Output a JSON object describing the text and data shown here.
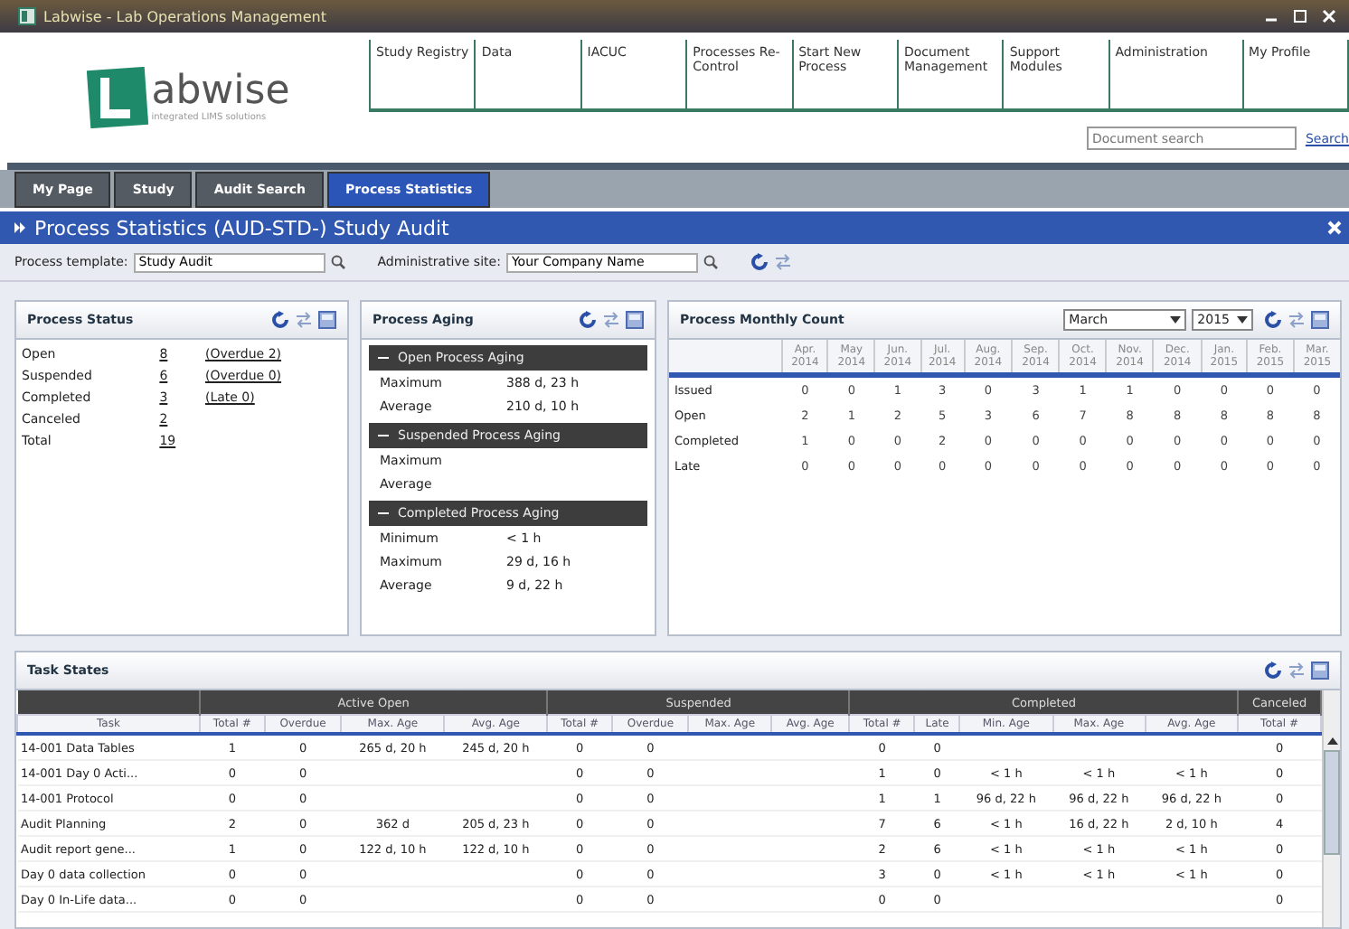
{
  "window": {
    "title": "Labwise - Lab Operations Management"
  },
  "logo": {
    "text": "abwise",
    "tagline": "integrated LIMS solutions"
  },
  "nav": [
    "Study Registry",
    "Data",
    "IACUC",
    "Processes Re-Control",
    "Start New Process",
    "Document Management",
    "Support Modules",
    "Administration",
    "My Profile"
  ],
  "search": {
    "placeholder": "Document search",
    "link": "Search"
  },
  "tabs": [
    {
      "label": "My Page",
      "selected": false
    },
    {
      "label": "Study",
      "selected": false
    },
    {
      "label": "Audit Search",
      "selected": false
    },
    {
      "label": "Process Statistics",
      "selected": true
    }
  ],
  "page_title": "Process Statistics (AUD-STD-) Study Audit",
  "filters": [
    {
      "label": "Process template:",
      "value": "Study Audit"
    },
    {
      "label": "Administrative site:",
      "value": "Your Company Name"
    }
  ],
  "process_status": {
    "title": "Process Status",
    "rows": [
      {
        "label": "Open",
        "count": "8",
        "note": "(Overdue 2)"
      },
      {
        "label": "Suspended",
        "count": "6",
        "note": "(Overdue 0)"
      },
      {
        "label": "Completed",
        "count": "3",
        "note": "(Late 0)"
      },
      {
        "label": "Canceled",
        "count": "2"
      },
      {
        "label": "Total",
        "count": "19"
      }
    ]
  },
  "process_aging": {
    "title": "Process Aging",
    "sections": [
      {
        "title": "Open Process Aging",
        "expanded": true,
        "rows": [
          {
            "label": "Maximum",
            "value": "388 d, 23 h"
          },
          {
            "label": "Average",
            "value": "210 d, 10 h"
          }
        ]
      },
      {
        "title": "Suspended Process Aging",
        "expanded": true,
        "rows": [
          {
            "label": "Maximum"
          },
          {
            "label": "Average"
          }
        ]
      },
      {
        "title": "Completed Process Aging",
        "expanded": true,
        "rows": [
          {
            "label": "Minimum",
            "value": "< 1 h"
          },
          {
            "label": "Maximum",
            "value": "29 d, 16 h"
          },
          {
            "label": "Average",
            "value": "9 d, 22 h"
          }
        ]
      }
    ]
  },
  "monthly_count": {
    "title": "Process Monthly Count",
    "month": "March",
    "year": "2015",
    "columns": [
      "Apr. 2014",
      "May 2014",
      "Jun. 2014",
      "Jul. 2014",
      "Aug. 2014",
      "Sep. 2014",
      "Oct. 2014",
      "Nov. 2014",
      "Dec. 2014",
      "Jan. 2015",
      "Feb. 2015",
      "Mar. 2015"
    ],
    "rows": [
      {
        "label": "Issued",
        "values": [
          "0",
          "0",
          "1",
          "3",
          "0",
          "3",
          "1",
          "1",
          "0",
          "0",
          "0",
          "0"
        ]
      },
      {
        "label": "Open",
        "values": [
          "2",
          "1",
          "2",
          "5",
          "3",
          "6",
          "7",
          "8",
          "8",
          "8",
          "8",
          "8"
        ]
      },
      {
        "label": "Completed",
        "values": [
          "1",
          "0",
          "0",
          "2",
          "0",
          "0",
          "0",
          "0",
          "0",
          "0",
          "0",
          "0"
        ]
      },
      {
        "label": "Late",
        "values": [
          "0",
          "0",
          "0",
          "0",
          "0",
          "0",
          "0",
          "0",
          "0",
          "0",
          "0",
          "0"
        ]
      }
    ]
  },
  "task_states": {
    "title": "Task States",
    "task_column": "Task",
    "groups": [
      {
        "label": "Active Open",
        "columns": [
          "Total #",
          "Overdue",
          "Max. Age",
          "Avg. Age"
        ]
      },
      {
        "label": "Suspended",
        "columns": [
          "Total #",
          "Overdue",
          "Max. Age",
          "Avg. Age"
        ]
      },
      {
        "label": "Completed",
        "columns": [
          "Total #",
          "Late",
          "Min. Age",
          "Max. Age",
          "Avg. Age"
        ]
      },
      {
        "label": "Canceled",
        "columns": [
          "Total #"
        ]
      }
    ],
    "rows": [
      [
        "14-001 Data Tables",
        "1",
        "0",
        "265 d, 20 h",
        "245 d, 20 h",
        "0",
        "0",
        null,
        null,
        "0",
        "0",
        null,
        null,
        null,
        "0"
      ],
      [
        "14-001 Day 0 Acti...",
        "0",
        "0",
        null,
        null,
        "0",
        "0",
        null,
        null,
        "1",
        "0",
        "< 1 h",
        "< 1 h",
        "< 1 h",
        "0"
      ],
      [
        "14-001 Protocol",
        "0",
        "0",
        null,
        null,
        "0",
        "0",
        null,
        null,
        "1",
        "1",
        "96 d, 22 h",
        "96 d, 22 h",
        "96 d, 22 h",
        "0"
      ],
      [
        "Audit Planning",
        "2",
        "0",
        "362 d",
        "205 d, 23 h",
        "0",
        "0",
        null,
        null,
        "7",
        "6",
        "< 1 h",
        "16 d, 22 h",
        "2 d, 10 h",
        "4"
      ],
      [
        "Audit report gene...",
        "1",
        "0",
        "122 d, 10 h",
        "122 d, 10 h",
        "0",
        "0",
        null,
        null,
        "2",
        "6",
        "< 1 h",
        "< 1 h",
        "< 1 h",
        "0"
      ],
      [
        "Day 0 data collection",
        "0",
        "0",
        null,
        null,
        "0",
        "0",
        null,
        null,
        "3",
        "0",
        "< 1 h",
        "< 1 h",
        "< 1 h",
        "0"
      ],
      [
        "Day 0 In-Life data...",
        "0",
        "0",
        null,
        null,
        "0",
        "0",
        null,
        null,
        "0",
        "0",
        null,
        null,
        null,
        "0"
      ]
    ]
  }
}
